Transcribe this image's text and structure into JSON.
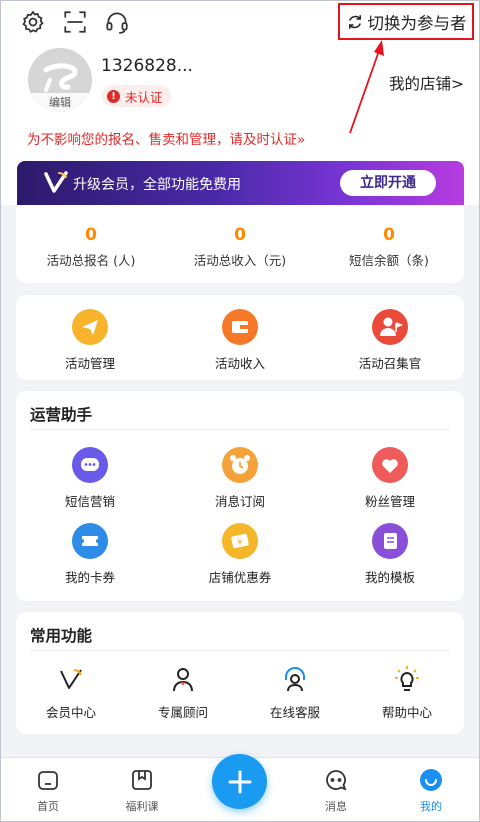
{
  "topbar": {
    "switch_label": "切换为参与者",
    "icons": [
      "settings-icon",
      "scan-icon",
      "headset-icon",
      "refresh-icon"
    ]
  },
  "profile": {
    "phone": "1326828...",
    "avatar_edit": "编辑",
    "badge": "未认证",
    "my_store": "我的店铺>",
    "warning": "为不影响您的报名、售卖和管理，请及时认证»"
  },
  "vip": {
    "text": "升级会员，全部功能免费用",
    "button": "立即开通"
  },
  "stats": [
    {
      "value": "0",
      "label": "活动总报名 (人)"
    },
    {
      "value": "0",
      "label": "活动总收入（元)"
    },
    {
      "value": "0",
      "label": "短信余额（条)"
    }
  ],
  "activity": [
    {
      "label": "活动管理",
      "icon": "paper-plane-icon",
      "color": "#f5a623"
    },
    {
      "label": "活动收入",
      "icon": "wallet-icon",
      "color": "#f57c20"
    },
    {
      "label": "活动召集官",
      "icon": "user-flag-icon",
      "color": "#e84a3a"
    }
  ],
  "ops": {
    "title": "运营助手",
    "items": [
      {
        "label": "短信营销",
        "icon": "chat-bubble-icon",
        "color": "#6a5ae8"
      },
      {
        "label": "消息订阅",
        "icon": "alarm-clock-icon",
        "color": "#f5a23a"
      },
      {
        "label": "粉丝管理",
        "icon": "heart-icon",
        "color": "#ef5a5a"
      },
      {
        "label": "我的卡券",
        "icon": "ticket-icon",
        "color": "#2f8be8"
      },
      {
        "label": "店铺优惠券",
        "icon": "coupon-icon",
        "color": "#f5b62a"
      },
      {
        "label": "我的模板",
        "icon": "template-icon",
        "color": "#8a4fd8"
      }
    ]
  },
  "common": {
    "title": "常用功能",
    "items": [
      {
        "label": "会员中心",
        "icon": "vip-v-icon"
      },
      {
        "label": "专属顾问",
        "icon": "advisor-icon"
      },
      {
        "label": "在线客服",
        "icon": "support-headset-icon"
      },
      {
        "label": "帮助中心",
        "icon": "lightbulb-icon"
      }
    ]
  },
  "tabs": [
    {
      "label": "首页",
      "icon": "home-icon"
    },
    {
      "label": "福利课",
      "icon": "bookmark-icon"
    },
    {
      "label": "消息",
      "icon": "message-icon"
    },
    {
      "label": "我的",
      "icon": "profile-icon",
      "active_color": "#1a8ff0"
    }
  ],
  "colors": {
    "accent_red": "#e02a2a",
    "stat_orange": "#ff8a00",
    "fab_blue": "#1a9af0"
  }
}
